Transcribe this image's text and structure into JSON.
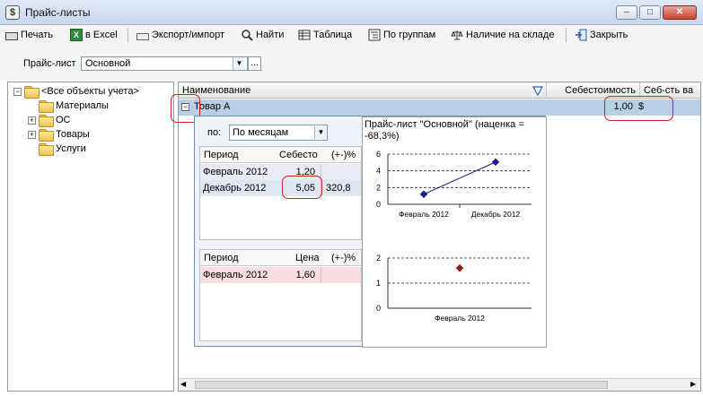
{
  "window": {
    "title": "Прайс-листы",
    "icon": "dollar-icon",
    "controls": [
      "minimize",
      "maximize",
      "close"
    ]
  },
  "toolbar": {
    "print": "Печать",
    "excel": "в Excel",
    "export_import": "Экспорт/импорт",
    "find": "Найти",
    "table": "Таблица",
    "by_groups": "По группам",
    "in_stock": "Наличие на складе",
    "close": "Закрыть"
  },
  "price_list": {
    "label": "Прайс-лист",
    "value": "Основной",
    "more": "..."
  },
  "tree": {
    "root": "<Все объекты учета>",
    "items": [
      {
        "label": "Материалы",
        "expandable": false
      },
      {
        "label": "ОС",
        "expandable": true
      },
      {
        "label": "Товары",
        "expandable": true
      },
      {
        "label": "Услуги",
        "expandable": false
      }
    ]
  },
  "grid": {
    "columns": [
      "Наименование",
      "Себестоимость",
      "Себ-сть ва"
    ],
    "filter_icon": "filter-icon",
    "row": {
      "name": "Товар А",
      "cost": "1,00",
      "currency": "$"
    }
  },
  "detail": {
    "by_label": "по:",
    "by_value": "По месяцам",
    "cost_table": {
      "columns": [
        "Период",
        "Себесто",
        "(+-)%"
      ],
      "rows": [
        {
          "period": "Февраль 2012",
          "value": "1,20",
          "pct": ""
        },
        {
          "period": "Декабрь 2012",
          "value": "5,05",
          "pct": "320,8"
        }
      ]
    },
    "price_table": {
      "columns": [
        "Период",
        "Цена",
        "(+-)%"
      ],
      "rows": [
        {
          "period": "Февраль 2012",
          "value": "1,60",
          "pct": ""
        }
      ]
    },
    "chart_title": "Прайс-лист \"Основной\"  (наценка = -68,3%)"
  },
  "chart_data": [
    {
      "type": "line",
      "categories": [
        "Февраль 2012",
        "Декабрь 2012"
      ],
      "values": [
        1.2,
        5.05
      ],
      "ylim": [
        0,
        6
      ],
      "yticks": [
        0,
        2,
        4,
        6
      ],
      "grid": true,
      "color": "#1a1a9a"
    },
    {
      "type": "scatter",
      "categories": [
        "Февраль 2012"
      ],
      "values": [
        1.6
      ],
      "ylim": [
        0,
        2
      ],
      "yticks": [
        0,
        1,
        2
      ],
      "grid": true,
      "color": "#a01818"
    }
  ]
}
